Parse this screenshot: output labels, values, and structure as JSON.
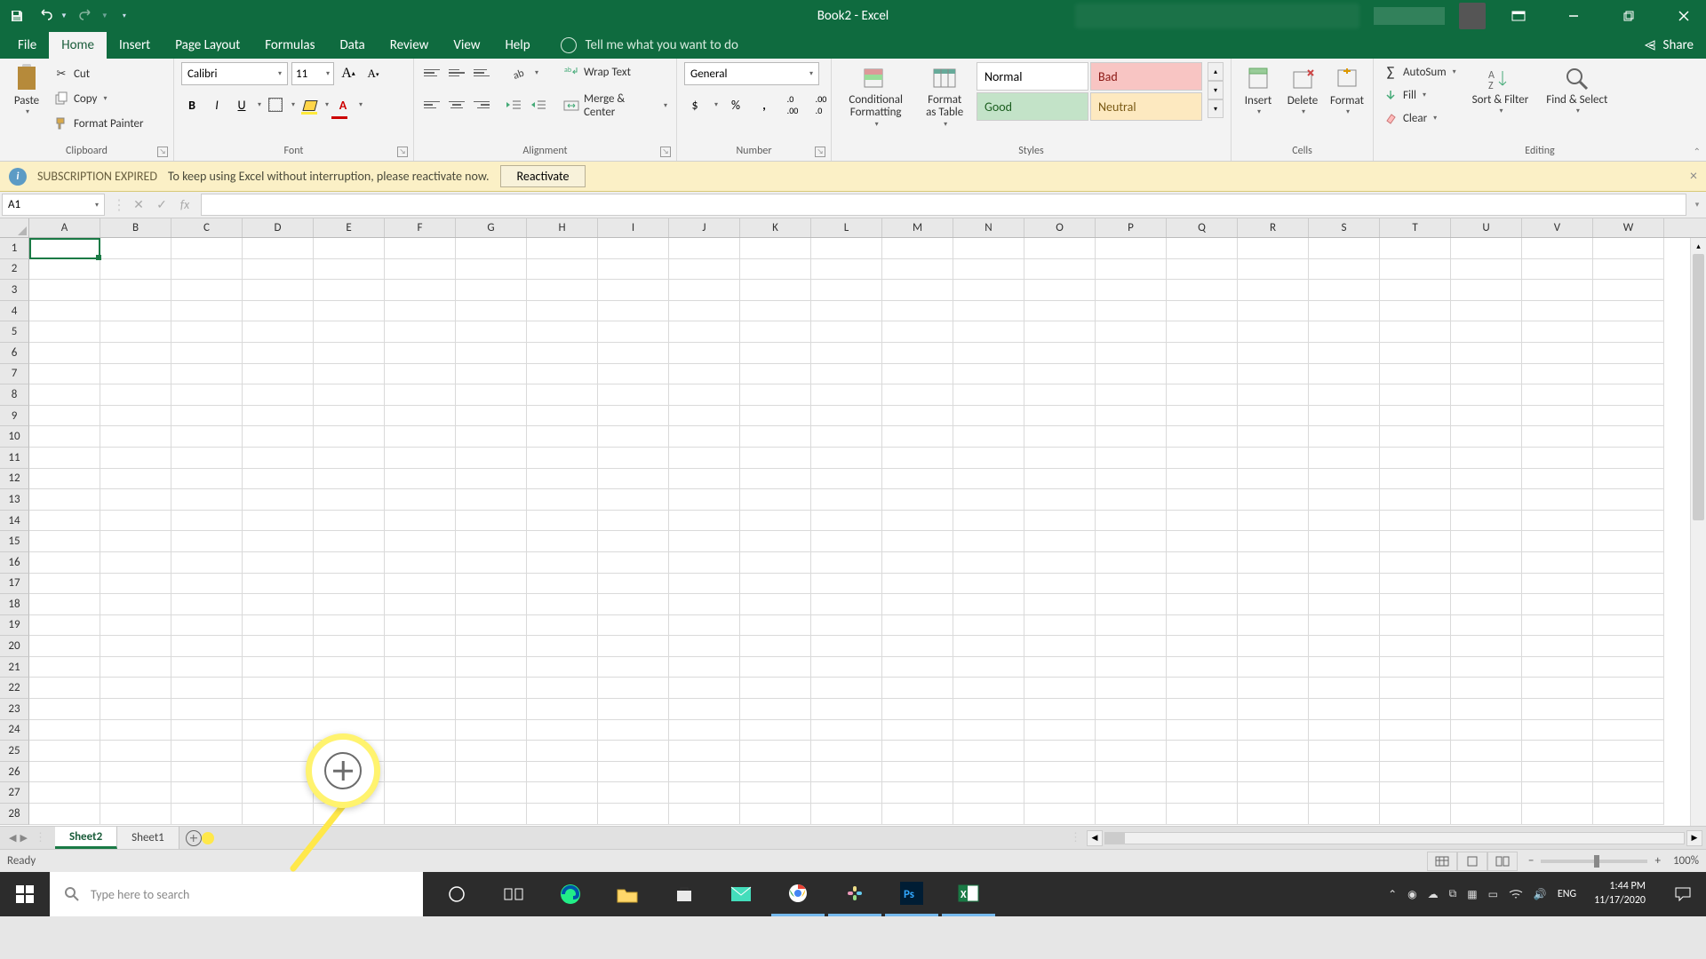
{
  "titlebar": {
    "title": "Book2 - Excel"
  },
  "tabs": {
    "file": "File",
    "home": "Home",
    "insert": "Insert",
    "page_layout": "Page Layout",
    "formulas": "Formulas",
    "data": "Data",
    "review": "Review",
    "view": "View",
    "help": "Help",
    "tell_me": "Tell me what you want to do",
    "share": "Share"
  },
  "ribbon": {
    "clipboard": {
      "label": "Clipboard",
      "paste": "Paste",
      "cut": "Cut",
      "copy": "Copy",
      "format_painter": "Format Painter"
    },
    "font": {
      "label": "Font",
      "name": "Calibri",
      "size": "11"
    },
    "alignment": {
      "label": "Alignment",
      "wrap": "Wrap Text",
      "merge": "Merge & Center"
    },
    "number": {
      "label": "Number",
      "format": "General"
    },
    "styles": {
      "label": "Styles",
      "conditional": "Conditional Formatting",
      "format_as": "Format as Table",
      "normal": "Normal",
      "bad": "Bad",
      "good": "Good",
      "neutral": "Neutral"
    },
    "cells": {
      "label": "Cells",
      "insert": "Insert",
      "delete": "Delete",
      "format": "Format"
    },
    "editing": {
      "label": "Editing",
      "autosum": "AutoSum",
      "fill": "Fill",
      "clear": "Clear",
      "sort": "Sort & Filter",
      "find": "Find & Select"
    }
  },
  "notify": {
    "title": "SUBSCRIPTION EXPIRED",
    "msg": "To keep using Excel without interruption, please reactivate now.",
    "button": "Reactivate"
  },
  "formula": {
    "namebox": "A1"
  },
  "columns": [
    "A",
    "B",
    "C",
    "D",
    "E",
    "F",
    "G",
    "H",
    "I",
    "J",
    "K",
    "L",
    "M",
    "N",
    "O",
    "P",
    "Q",
    "R",
    "S",
    "T",
    "U",
    "V",
    "W"
  ],
  "rows": [
    1,
    2,
    3,
    4,
    5,
    6,
    7,
    8,
    9,
    10,
    11,
    12,
    13,
    14,
    15,
    16,
    17,
    18,
    19,
    20,
    21,
    22,
    23,
    24,
    25,
    26,
    27,
    28
  ],
  "sheets": {
    "active": "Sheet2",
    "other": "Sheet1"
  },
  "status": {
    "ready": "Ready",
    "zoom": "100%"
  },
  "taskbar": {
    "search_placeholder": "Type here to search",
    "lang": "ENG",
    "time": "1:44 PM",
    "date": "11/17/2020"
  }
}
